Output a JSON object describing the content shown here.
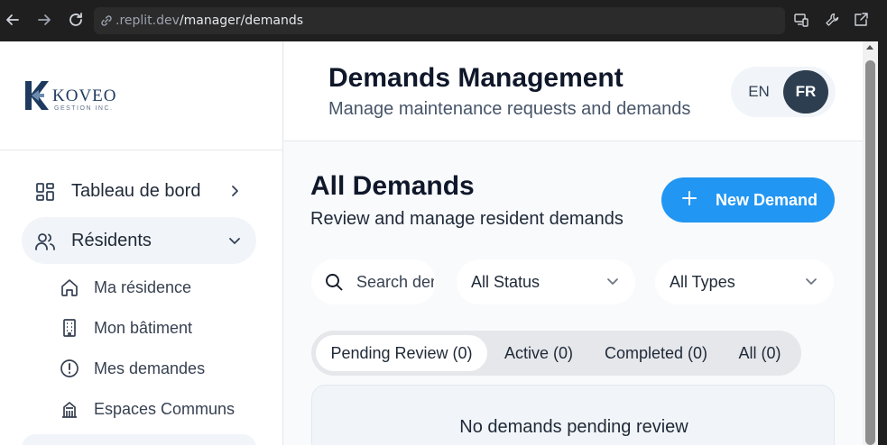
{
  "browser": {
    "url_host": ".replit.dev",
    "url_path": "/manager/demands"
  },
  "sidebar": {
    "logo": {
      "brand": "KOVEO",
      "sub": "GESTION INC."
    },
    "items": [
      {
        "label": "Tableau de bord",
        "icon": "dashboard-icon"
      },
      {
        "label": "Résidents",
        "icon": "users-icon",
        "expanded": true
      }
    ],
    "sub_items": [
      {
        "label": "Ma résidence",
        "icon": "home-icon"
      },
      {
        "label": "Mon bâtiment",
        "icon": "building-icon"
      },
      {
        "label": "Mes demandes",
        "icon": "alert-circle-icon"
      },
      {
        "label": "Espaces Communs",
        "icon": "common-spaces-icon"
      }
    ]
  },
  "header": {
    "title": "Demands Management",
    "subtitle": "Manage maintenance requests and demands",
    "lang_en": "EN",
    "lang_fr": "FR",
    "lang_active": "FR"
  },
  "main": {
    "title": "All Demands",
    "subtitle": "Review and manage resident demands",
    "new_button_label": "New Demand",
    "search_placeholder": "Search demands...",
    "status_filter": "All Status",
    "type_filter": "All Types",
    "tabs": [
      {
        "label": "Pending Review (0)",
        "active": true
      },
      {
        "label": "Active (0)"
      },
      {
        "label": "Completed (0)"
      },
      {
        "label": "All (0)"
      }
    ],
    "empty_message": "No demands pending review"
  },
  "colors": {
    "primary": "#2196f3",
    "lang_active_bg": "#2d3e50",
    "sidebar_active_bg": "#f1f5f9",
    "logo": "#1e3a5f"
  }
}
